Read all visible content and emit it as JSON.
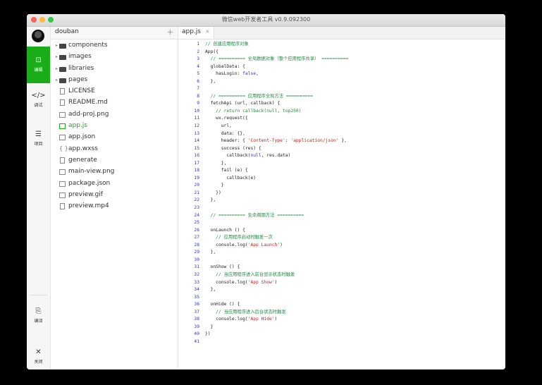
{
  "window": {
    "title": "微信web开发者工具 v0.9.092300"
  },
  "iconbar": {
    "items": [
      {
        "icon": "editor-icon",
        "glyph": "⊡",
        "label": "编辑",
        "active": true
      },
      {
        "icon": "debug-icon",
        "glyph": "</>",
        "label": "调试",
        "active": false
      },
      {
        "icon": "project-icon",
        "glyph": "☰",
        "label": "项目",
        "active": false
      },
      {
        "icon": "compile-icon",
        "glyph": "⎘",
        "label": "编译",
        "active": false
      },
      {
        "icon": "close-icon",
        "glyph": "✕",
        "label": "关闭",
        "active": false
      }
    ]
  },
  "sidebar": {
    "project_name": "douban",
    "add_glyph": "+",
    "files": [
      {
        "name": "components",
        "kind": "folder",
        "active": false
      },
      {
        "name": "images",
        "kind": "folder",
        "active": false
      },
      {
        "name": "libraries",
        "kind": "folder",
        "active": false
      },
      {
        "name": "pages",
        "kind": "folder",
        "active": false
      },
      {
        "name": "LICENSE",
        "kind": "file",
        "active": false
      },
      {
        "name": "README.md",
        "kind": "file",
        "active": false
      },
      {
        "name": "add-proj.png",
        "kind": "image",
        "active": false
      },
      {
        "name": "app.js",
        "kind": "image",
        "active": true
      },
      {
        "name": "app.json",
        "kind": "image",
        "active": false
      },
      {
        "name": "app.wxss",
        "kind": "brace",
        "active": false
      },
      {
        "name": "generate",
        "kind": "file",
        "active": false
      },
      {
        "name": "main-view.png",
        "kind": "image",
        "active": false
      },
      {
        "name": "package.json",
        "kind": "image",
        "active": false
      },
      {
        "name": "preview.gif",
        "kind": "image",
        "active": false
      },
      {
        "name": "preview.mp4",
        "kind": "file",
        "active": false
      }
    ]
  },
  "editor": {
    "tab": {
      "label": "app.js",
      "close_glyph": "×"
    },
    "lines": [
      {
        "n": "1",
        "text": "// 创建应用程序对象",
        "kind": "comment"
      },
      {
        "n": "2",
        "text": "App({",
        "kind": "code"
      },
      {
        "n": "3",
        "text": "  // ========== 全局数据对象（整个应用程序共享） ==========",
        "kind": "comment"
      },
      {
        "n": "4",
        "text": "  globalData: {",
        "kind": "code"
      },
      {
        "n": "5",
        "text": "    hasLogin: false,",
        "kind": "code"
      },
      {
        "n": "6",
        "text": "  },",
        "kind": "code"
      },
      {
        "n": "7",
        "text": "",
        "kind": "code"
      },
      {
        "n": "8",
        "text": "  // ========== 应用程序全局方法 ==========",
        "kind": "comment"
      },
      {
        "n": "9",
        "text": "  fetchApi (url, callback) {",
        "kind": "code"
      },
      {
        "n": "10",
        "text": "    // return callback(null, top250)",
        "kind": "comment"
      },
      {
        "n": "11",
        "text": "    wx.request({",
        "kind": "code"
      },
      {
        "n": "12",
        "text": "      url,",
        "kind": "code"
      },
      {
        "n": "13",
        "text": "      data: {},",
        "kind": "code"
      },
      {
        "n": "14",
        "text": "      header: { 'Content-Type': 'application/json' },",
        "kind": "code"
      },
      {
        "n": "15",
        "text": "      success (res) {",
        "kind": "code"
      },
      {
        "n": "16",
        "text": "        callback(null, res.data)",
        "kind": "code"
      },
      {
        "n": "17",
        "text": "      },",
        "kind": "code"
      },
      {
        "n": "18",
        "text": "      fail (e) {",
        "kind": "code"
      },
      {
        "n": "19",
        "text": "        callback(e)",
        "kind": "code"
      },
      {
        "n": "20",
        "text": "      }",
        "kind": "code"
      },
      {
        "n": "21",
        "text": "    })",
        "kind": "code"
      },
      {
        "n": "22",
        "text": "  },",
        "kind": "code"
      },
      {
        "n": "23",
        "text": "",
        "kind": "code"
      },
      {
        "n": "24",
        "text": "  // ========== 生命周期方法 ==========",
        "kind": "comment"
      },
      {
        "n": "25",
        "text": "",
        "kind": "code"
      },
      {
        "n": "26",
        "text": "  onLaunch () {",
        "kind": "code"
      },
      {
        "n": "27",
        "text": "    // 应用程序启动时触发一次",
        "kind": "comment"
      },
      {
        "n": "28",
        "text": "    console.log('App Launch')",
        "kind": "code"
      },
      {
        "n": "29",
        "text": "  },",
        "kind": "code"
      },
      {
        "n": "30",
        "text": "",
        "kind": "code"
      },
      {
        "n": "31",
        "text": "  onShow () {",
        "kind": "code"
      },
      {
        "n": "32",
        "text": "    // 当应用程序进入前台显示状态时触发",
        "kind": "comment"
      },
      {
        "n": "33",
        "text": "    console.log('App Show')",
        "kind": "code"
      },
      {
        "n": "34",
        "text": "  },",
        "kind": "code"
      },
      {
        "n": "35",
        "text": "",
        "kind": "code"
      },
      {
        "n": "36",
        "text": "  onHide () {",
        "kind": "code"
      },
      {
        "n": "37",
        "text": "    // 当应用程序进入后台状态时触发",
        "kind": "comment"
      },
      {
        "n": "38",
        "text": "    console.log('App Hide')",
        "kind": "code"
      },
      {
        "n": "39",
        "text": "  }",
        "kind": "code"
      },
      {
        "n": "40",
        "text": "})",
        "kind": "code"
      },
      {
        "n": "41",
        "text": "",
        "kind": "code"
      }
    ]
  },
  "colors": {
    "accent": "#1aad19",
    "line_number": "#2a35c9",
    "comment": "#1c8a3e",
    "string": "#b3261e"
  }
}
